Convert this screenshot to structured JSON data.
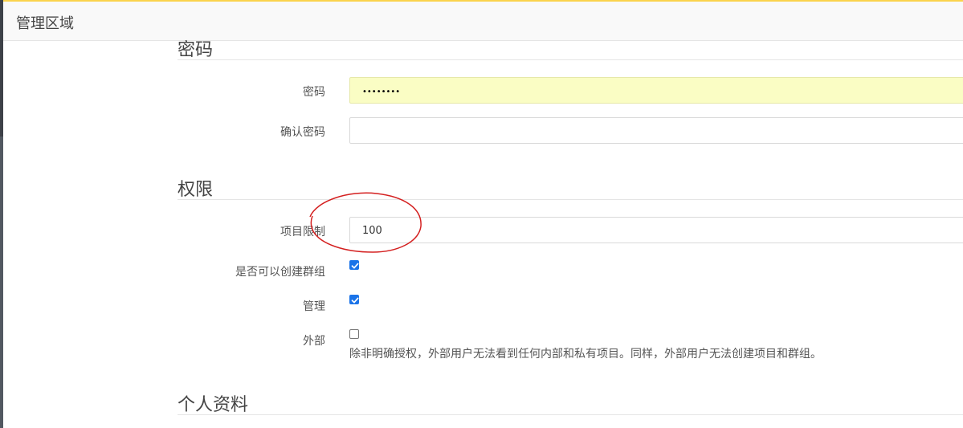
{
  "header": {
    "title": "管理区域"
  },
  "sections": {
    "password": {
      "title": "密码",
      "password_label": "密码",
      "password_value": "••••••••",
      "confirm_label": "确认密码",
      "confirm_value": ""
    },
    "permissions": {
      "title": "权限",
      "project_limit_label": "项目限制",
      "project_limit_value": "100",
      "can_create_group_label": "是否可以创建群组",
      "can_create_group_checked": true,
      "admin_label": "管理",
      "admin_checked": true,
      "external_label": "外部",
      "external_checked": false,
      "external_help": "除非明确授权，外部用户无法看到任何内部和私有项目。同样，外部用户无法创建项目和群组。"
    },
    "profile": {
      "title": "个人资料"
    }
  },
  "colors": {
    "accent_top": "#fbd34d",
    "autofill_bg": "#fafdc4",
    "checkbox_blue": "#1a73e8",
    "annotation_red": "#d42020"
  },
  "icons": {
    "checkmark": "check-icon"
  }
}
